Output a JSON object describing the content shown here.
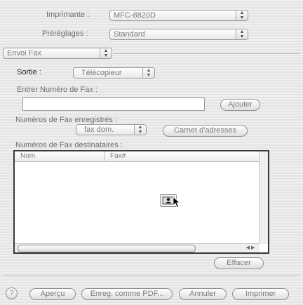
{
  "printer": {
    "label": "Imprimante :",
    "value": "MFC-8820D"
  },
  "presets": {
    "label": "Préréglages :",
    "value": "Standard"
  },
  "panel_select": {
    "value": "Envoi Fax"
  },
  "output": {
    "label": "Sortie :",
    "value": "Télécopieur"
  },
  "fax_number": {
    "label": "Entrer Numéro de Fax :",
    "value": "",
    "add_button": "Ajouter"
  },
  "saved_numbers": {
    "label": "Numéros de Fax enregistrés :",
    "value": "fax dom.",
    "address_book_button": "Carnet d'adresses"
  },
  "recipients": {
    "label": "Numéros de Fax destinataires :",
    "columns": [
      "Nom",
      "Fax#"
    ],
    "rows": [],
    "delete_button": "Effacer"
  },
  "footer": {
    "help": "?",
    "preview": "Aperçu",
    "save_pdf": "Enreg. comme PDF...",
    "cancel": "Annuler",
    "print": "Imprimer"
  },
  "icons": {
    "popup_arrows": "up-down-arrows-icon",
    "drag_item": "address-card-drag-icon",
    "cursor": "pointer-cursor-icon",
    "scroll_left": "scroll-left-arrow-icon",
    "scroll_right": "scroll-right-arrow-icon"
  }
}
